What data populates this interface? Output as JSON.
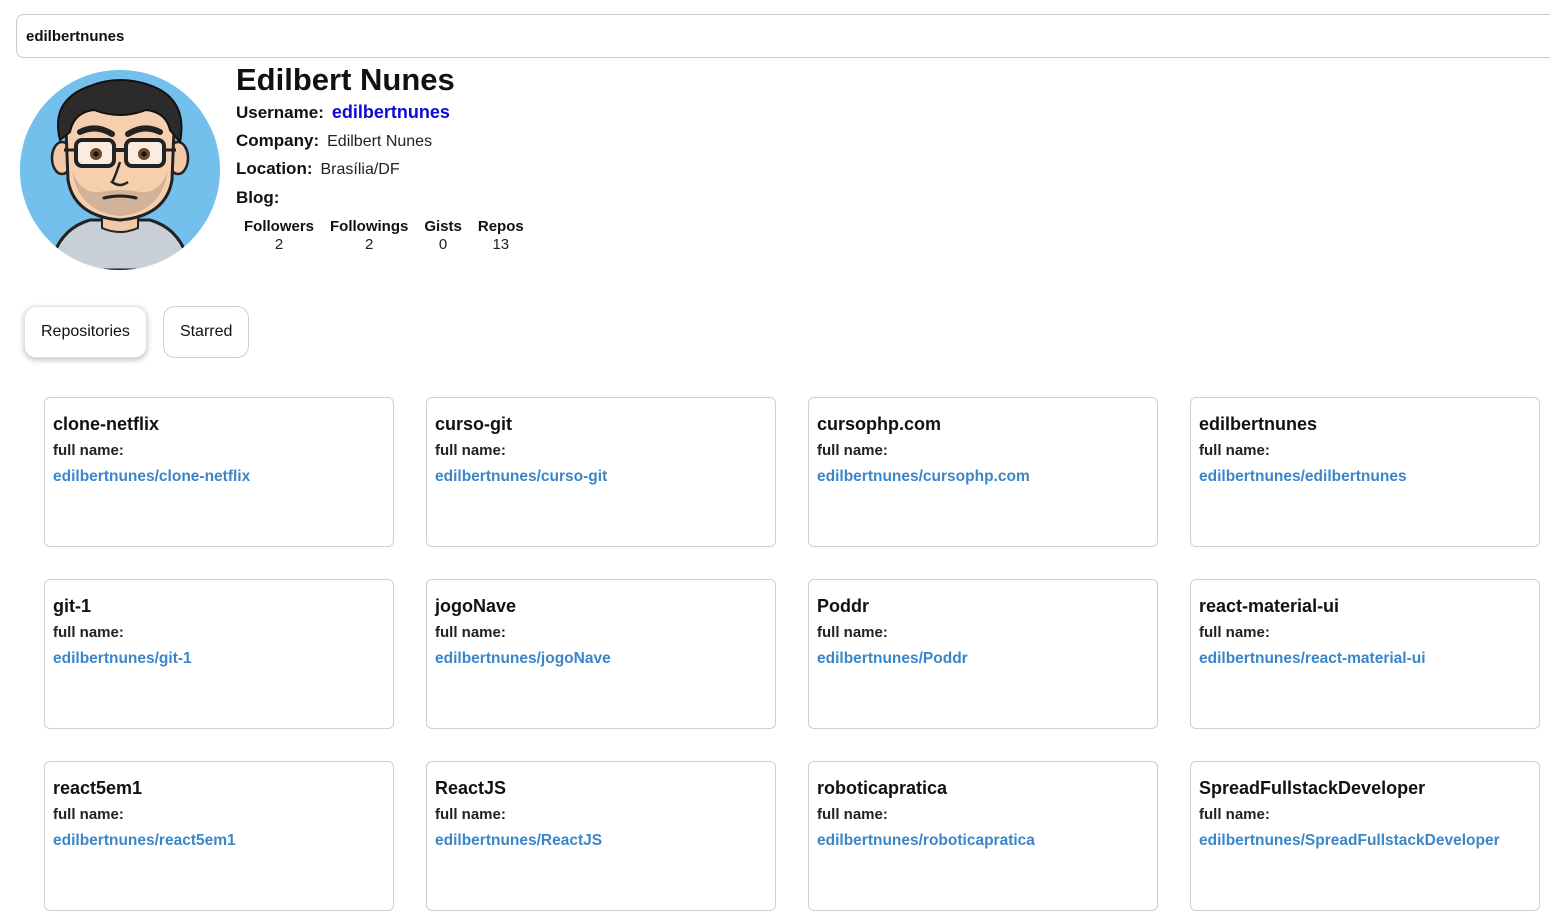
{
  "search": {
    "value": "edilbertnunes"
  },
  "profile": {
    "name": "Edilbert Nunes",
    "username_label": "Username:",
    "username": "edilbertnunes",
    "company_label": "Company:",
    "company": "Edilbert Nunes",
    "location_label": "Location:",
    "location": "Brasília/DF",
    "blog_label": "Blog:",
    "blog": ""
  },
  "stats": [
    {
      "label": "Followers",
      "value": "2"
    },
    {
      "label": "Followings",
      "value": "2"
    },
    {
      "label": "Gists",
      "value": "0"
    },
    {
      "label": "Repos",
      "value": "13"
    }
  ],
  "tabs": [
    {
      "label": "Repositories",
      "active": true
    },
    {
      "label": "Starred",
      "active": false
    }
  ],
  "repos": [
    {
      "name": "clone-netflix",
      "full_name_label": "full name:",
      "full_name": "edilbertnunes/clone-netflix"
    },
    {
      "name": "curso-git",
      "full_name_label": "full name:",
      "full_name": "edilbertnunes/curso-git"
    },
    {
      "name": "cursophp.com",
      "full_name_label": "full name:",
      "full_name": "edilbertnunes/cursophp.com"
    },
    {
      "name": "edilbertnunes",
      "full_name_label": "full name:",
      "full_name": "edilbertnunes/edilbertnunes"
    },
    {
      "name": "git-1",
      "full_name_label": "full name:",
      "full_name": "edilbertnunes/git-1"
    },
    {
      "name": "jogoNave",
      "full_name_label": "full name:",
      "full_name": "edilbertnunes/jogoNave"
    },
    {
      "name": "Poddr",
      "full_name_label": "full name:",
      "full_name": "edilbertnunes/Poddr"
    },
    {
      "name": "react-material-ui",
      "full_name_label": "full name:",
      "full_name": "edilbertnunes/react-material-ui"
    },
    {
      "name": "react5em1",
      "full_name_label": "full name:",
      "full_name": "edilbertnunes/react5em1"
    },
    {
      "name": "ReactJS",
      "full_name_label": "full name:",
      "full_name": "edilbertnunes/ReactJS"
    },
    {
      "name": "roboticapratica",
      "full_name_label": "full name:",
      "full_name": "edilbertnunes/roboticapratica"
    },
    {
      "name": "SpreadFullstackDeveloper",
      "full_name_label": "full name:",
      "full_name": "edilbertnunes/SpreadFullstackDeveloper"
    }
  ],
  "colors": {
    "link": "#0a0ad6",
    "repo_link": "#3b86c8",
    "avatar_bg": "#74c0ec"
  }
}
